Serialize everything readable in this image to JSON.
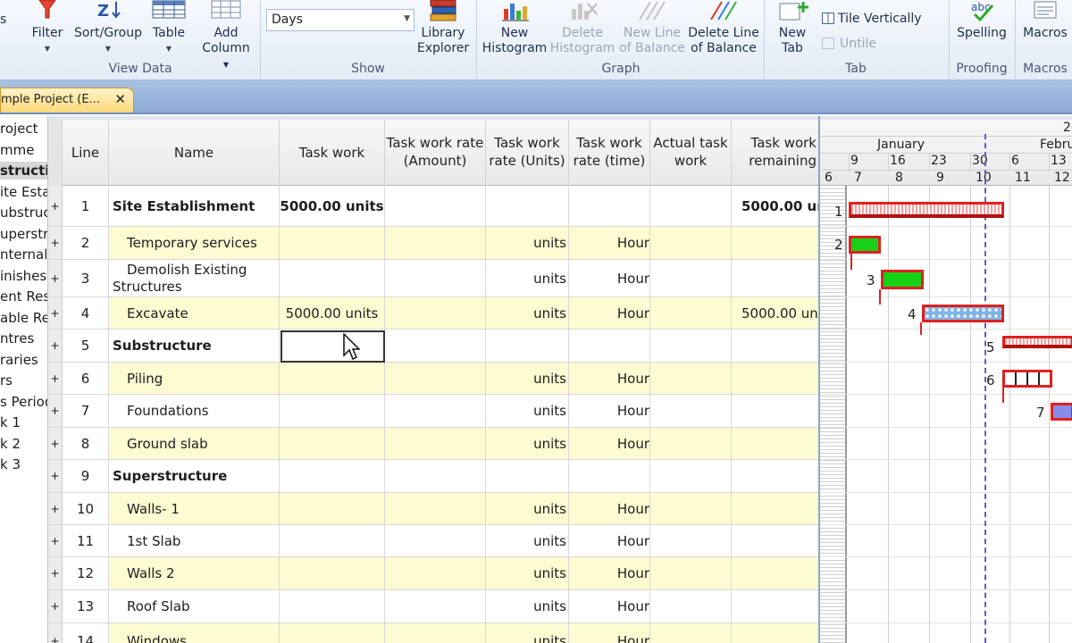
{
  "ribbon": {
    "view_data_buttons": [
      {
        "label": "Filter",
        "dropdown": true
      },
      {
        "label": "Sort/Group",
        "dropdown": true
      },
      {
        "label": "Table",
        "dropdown": true
      },
      {
        "label": "Add",
        "label2": "Column",
        "dropdown": true
      }
    ],
    "view_data_label": "View Data",
    "days_select": "Days",
    "show_label": "Show",
    "library_label": "Library",
    "library_label2": "Explorer",
    "graph_buttons": [
      {
        "label": "New",
        "label2": "Histogram",
        "disabled": false
      },
      {
        "label": "Delete",
        "label2": "Histogram",
        "disabled": true
      },
      {
        "label": "New Line",
        "label2": "of Balance",
        "disabled": true
      },
      {
        "label": "Delete Line",
        "label2": "of Balance",
        "disabled": false
      }
    ],
    "graph_label": "Graph",
    "new_tab_label": "New",
    "new_tab_label2": "Tab",
    "tile_vertically": "Tile Vertically",
    "untile": "Untile",
    "tab_label": "Tab",
    "spelling": "Spelling",
    "proofing_label": "Proofing",
    "macros": "Macros",
    "macros_label": "Macros"
  },
  "doc_tab": {
    "title": "mple Project (E...",
    "close": "✕"
  },
  "tree": [
    "roject",
    "mme",
    "structi",
    "ite Esta",
    "ubstruc",
    "uperstr",
    "nternals",
    "inishes",
    "ent Res",
    "able Re",
    "ntres",
    "raries",
    "rs",
    "s Period",
    "k 1",
    "k 2",
    "k 3"
  ],
  "tree_selected": 2,
  "columns": {
    "line": "Line",
    "name": "Name",
    "task_work": "Task work",
    "twr_amount": "Task work rate (Amount)",
    "twr_units": "Task work rate (Units)",
    "twr_time": "Task work rate (time)",
    "actual": "Actual task work",
    "remaining": "Task work remaining"
  },
  "rows": [
    {
      "line": "1",
      "name": "Site Establishment",
      "bold": true,
      "task_work": "5000.00 units",
      "units": "",
      "time": "",
      "remaining": "5000.00 un"
    },
    {
      "line": "2",
      "name": "Temporary services",
      "bold": false,
      "task_work": "",
      "units": "units",
      "time": "Hour",
      "remaining": ""
    },
    {
      "line": "3",
      "name": "Demolish Existing Structures",
      "bold": false,
      "task_work": "",
      "units": "units",
      "time": "Hour",
      "remaining": ""
    },
    {
      "line": "4",
      "name": "Excavate",
      "bold": false,
      "task_work": "5000.00 units",
      "units": "units",
      "time": "Hour",
      "remaining": "5000.00 un"
    },
    {
      "line": "5",
      "name": "Substructure",
      "bold": true,
      "task_work": "",
      "units": "",
      "time": "",
      "remaining": ""
    },
    {
      "line": "6",
      "name": "Piling",
      "bold": false,
      "task_work": "",
      "units": "units",
      "time": "Hour",
      "remaining": ""
    },
    {
      "line": "7",
      "name": "Foundations",
      "bold": false,
      "task_work": "",
      "units": "units",
      "time": "Hour",
      "remaining": ""
    },
    {
      "line": "8",
      "name": "Ground slab",
      "bold": false,
      "task_work": "",
      "units": "units",
      "time": "Hour",
      "remaining": ""
    },
    {
      "line": "9",
      "name": "Superstructure",
      "bold": true,
      "task_work": "",
      "units": "",
      "time": "",
      "remaining": ""
    },
    {
      "line": "10",
      "name": "Walls- 1",
      "bold": false,
      "task_work": "",
      "units": "units",
      "time": "Hour",
      "remaining": ""
    },
    {
      "line": "11",
      "name": "1st Slab",
      "bold": false,
      "task_work": "",
      "units": "units",
      "time": "Hour",
      "remaining": ""
    },
    {
      "line": "12",
      "name": "Walls  2",
      "bold": false,
      "task_work": "",
      "units": "units",
      "time": "Hour",
      "remaining": ""
    },
    {
      "line": "13",
      "name": "Roof Slab",
      "bold": false,
      "task_work": "",
      "units": "units",
      "time": "Hour",
      "remaining": ""
    },
    {
      "line": "14",
      "name": "Windows",
      "bold": false,
      "task_work": "",
      "units": "units",
      "time": "Hour",
      "remaining": ""
    }
  ],
  "expand_glyph": "+",
  "gantt": {
    "year": "20",
    "months": [
      "January",
      "Febru"
    ],
    "weeks": [
      "9",
      "16",
      "23",
      "30",
      "6",
      "13"
    ],
    "week_numbers": [
      "6",
      "7",
      "8",
      "9",
      "10",
      "11",
      "12"
    ],
    "bar_labels": [
      "1",
      "2",
      "3",
      "4",
      "5",
      "6",
      "7"
    ],
    "colors": {
      "summary": "#e02020",
      "task": "#17d117",
      "pattern": "#7fb5e6",
      "task7": "#8a8ae8",
      "today": "#5b5bd6"
    }
  }
}
